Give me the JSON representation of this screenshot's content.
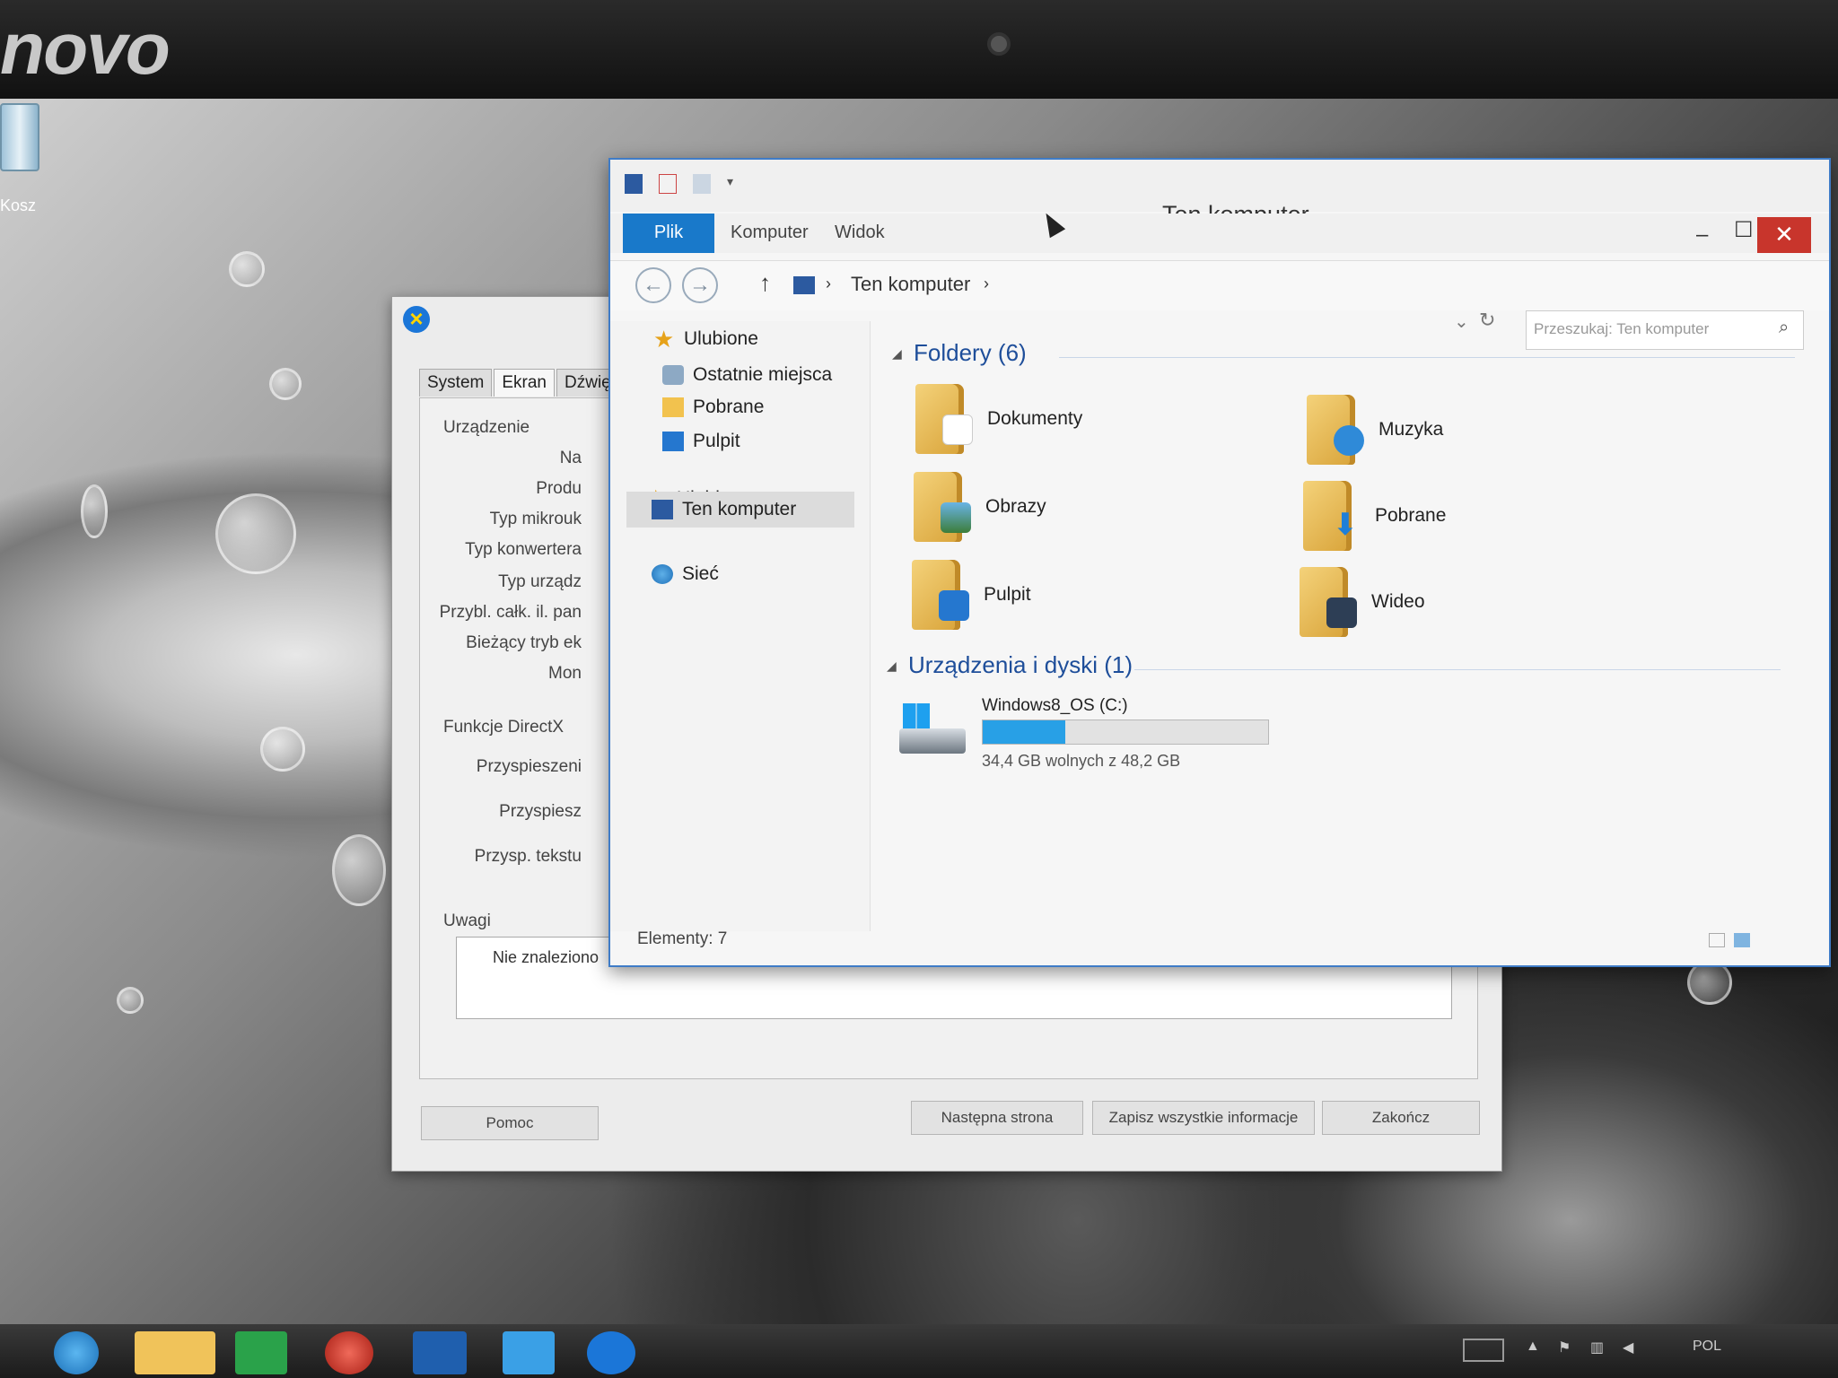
{
  "monitor": {
    "brand": "novo"
  },
  "desktop": {
    "recycle_bin_label": "Kosz"
  },
  "dxdiag": {
    "tabs": [
      "System",
      "Ekran",
      "Dźwię"
    ],
    "group_device": "Urządzenie",
    "labels": [
      "Na",
      "Produ",
      "Typ mikrouk",
      "Typ konwertera",
      "Typ urządz",
      "Przybl. całk. il. pan",
      "Bieżący tryb ek",
      "Mon"
    ],
    "group_directx": "Funkcje DirectX",
    "dx_labels": [
      "Przyspieszeni",
      "Przyspiesz",
      "Przysp. tekstu"
    ],
    "notes_title": "Uwagi",
    "note": "Nie znaleziono",
    "buttons": {
      "help": "Pomoc",
      "next": "Następna strona",
      "save": "Zapisz wszystkie informacje",
      "exit": "Zakończ"
    }
  },
  "explorer": {
    "title": "Ten komputer",
    "ribbon_tabs": {
      "file": "Plik",
      "computer": "Komputer",
      "view": "Widok"
    },
    "breadcrumb": "Ten komputer",
    "search_placeholder": "Przeszukaj: Ten komputer",
    "nav": {
      "favorites": "Ulubione",
      "recent": "Ostatnie miejsca",
      "downloads": "Pobrane",
      "desktop": "Pulpit",
      "this_pc": "Ten komputer",
      "network": "Sieć"
    },
    "folders_header": "Foldery (6)",
    "folders": {
      "documents": "Dokumenty",
      "music": "Muzyka",
      "pictures": "Obrazy",
      "downloads": "Pobrane",
      "desktop": "Pulpit",
      "videos": "Wideo"
    },
    "devices_header": "Urządzenia i dyski (1)",
    "drive": {
      "name": "Windows8_OS (C:)",
      "free_text": "34,4 GB wolnych z 48,2 GB",
      "used_fraction": 0.29
    },
    "status": "Elementy: 7"
  },
  "taskbar": {
    "tray_lang": "POL"
  }
}
